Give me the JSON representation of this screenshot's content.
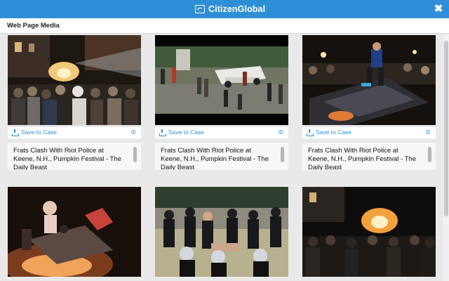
{
  "app": {
    "brand": "CitizenGlobal",
    "close_glyph": "✖"
  },
  "subbar": {
    "title": "Web Page Media"
  },
  "cards": [
    {
      "save_label": "Save to Case",
      "title": "Frats Clash With Riot Police at Keene, N.H., Pumpkin Festival - The Daily Beast",
      "image_icon": "crowd-bonfire-photo"
    },
    {
      "save_label": "Save to Case",
      "title": "Frats Clash With Riot Police at Keene, N.H., Pumpkin Festival - The Daily Beast",
      "image_icon": "overturned-car-photo"
    },
    {
      "save_label": "Save to Case",
      "title": "Frats Clash With Riot Police at Keene, N.H., Pumpkin Festival - The Daily Beast",
      "image_icon": "man-on-car-photo"
    },
    {
      "image_icon": "fire-stop-sign-photo"
    },
    {
      "image_icon": "riot-police-arrest-photo"
    },
    {
      "image_icon": "night-bonfire-photo"
    }
  ],
  "colors": {
    "accent": "#2f8fd6",
    "background": "#e9e9e9"
  }
}
